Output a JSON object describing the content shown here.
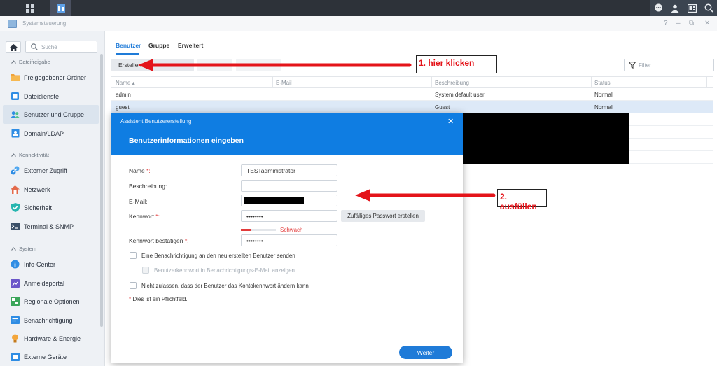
{
  "window": {
    "title": "Systemsteuerung"
  },
  "sidebar": {
    "search_placeholder": "Suche",
    "sections": [
      {
        "label": "Dateifreigabe"
      },
      {
        "label": "Konnektivität"
      },
      {
        "label": "System"
      }
    ],
    "items": [
      {
        "label": "Freigegebener Ordner",
        "icon": "folder-icon"
      },
      {
        "label": "Dateidienste",
        "icon": "file-services-icon"
      },
      {
        "label": "Benutzer und Gruppe",
        "icon": "users-icon",
        "selected": true
      },
      {
        "label": "Domain/LDAP",
        "icon": "domain-icon"
      },
      {
        "label": "Externer Zugriff",
        "icon": "external-access-icon"
      },
      {
        "label": "Netzwerk",
        "icon": "network-icon"
      },
      {
        "label": "Sicherheit",
        "icon": "shield-icon"
      },
      {
        "label": "Terminal & SNMP",
        "icon": "terminal-icon"
      },
      {
        "label": "Info-Center",
        "icon": "info-icon"
      },
      {
        "label": "Anmeldeportal",
        "icon": "portal-icon"
      },
      {
        "label": "Regionale Optionen",
        "icon": "region-icon"
      },
      {
        "label": "Benachrichtigung",
        "icon": "notification-icon"
      },
      {
        "label": "Hardware & Energie",
        "icon": "hardware-icon"
      },
      {
        "label": "Externe Geräte",
        "icon": "external-devices-icon"
      }
    ]
  },
  "tabs": [
    "Benutzer",
    "Gruppe",
    "Erweitert"
  ],
  "toolbar": {
    "create_label": "Erstellen",
    "filter_placeholder": "Filter"
  },
  "table": {
    "columns": [
      "Name",
      "E-Mail",
      "Beschreibung",
      "Status"
    ],
    "rows": [
      {
        "name": "admin",
        "email": "",
        "description": "System default user",
        "status": "Normal"
      },
      {
        "name": "guest",
        "email": "",
        "description": "Guest",
        "status": "Normal"
      }
    ]
  },
  "annotations": {
    "step1": "1. hier klicken",
    "step2": "2. ausfüllen"
  },
  "dialog": {
    "title": "Assistent Benutzererstellung",
    "heading": "Benutzerinformationen eingeben",
    "labels": {
      "name": "Name",
      "description": "Beschreibung:",
      "email": "E-Mail:",
      "password": "Kennwort",
      "confirm": "Kennwort bestätigen"
    },
    "values": {
      "name": "TESTadministrator",
      "description": "",
      "password": "••••••••",
      "confirm": "••••••••"
    },
    "generate_button": "Zufälliges Passwort erstellen",
    "strength": {
      "label": "Schwach",
      "level": 0.3
    },
    "checkboxes": [
      "Eine Benachrichtigung an den neu erstellten Benutzer senden",
      "Benutzerkennwort in Benachrichtigungs-E-Mail anzeigen",
      "Nicht zulassen, dass der Benutzer das Kontokennwort ändern kann"
    ],
    "required_note": "Dies ist ein Pflichtfeld.",
    "next_button": "Weiter"
  },
  "colors": {
    "accent": "#1f7bd8",
    "dialog_header": "#0f7de2",
    "annotation": "#e4141a"
  }
}
